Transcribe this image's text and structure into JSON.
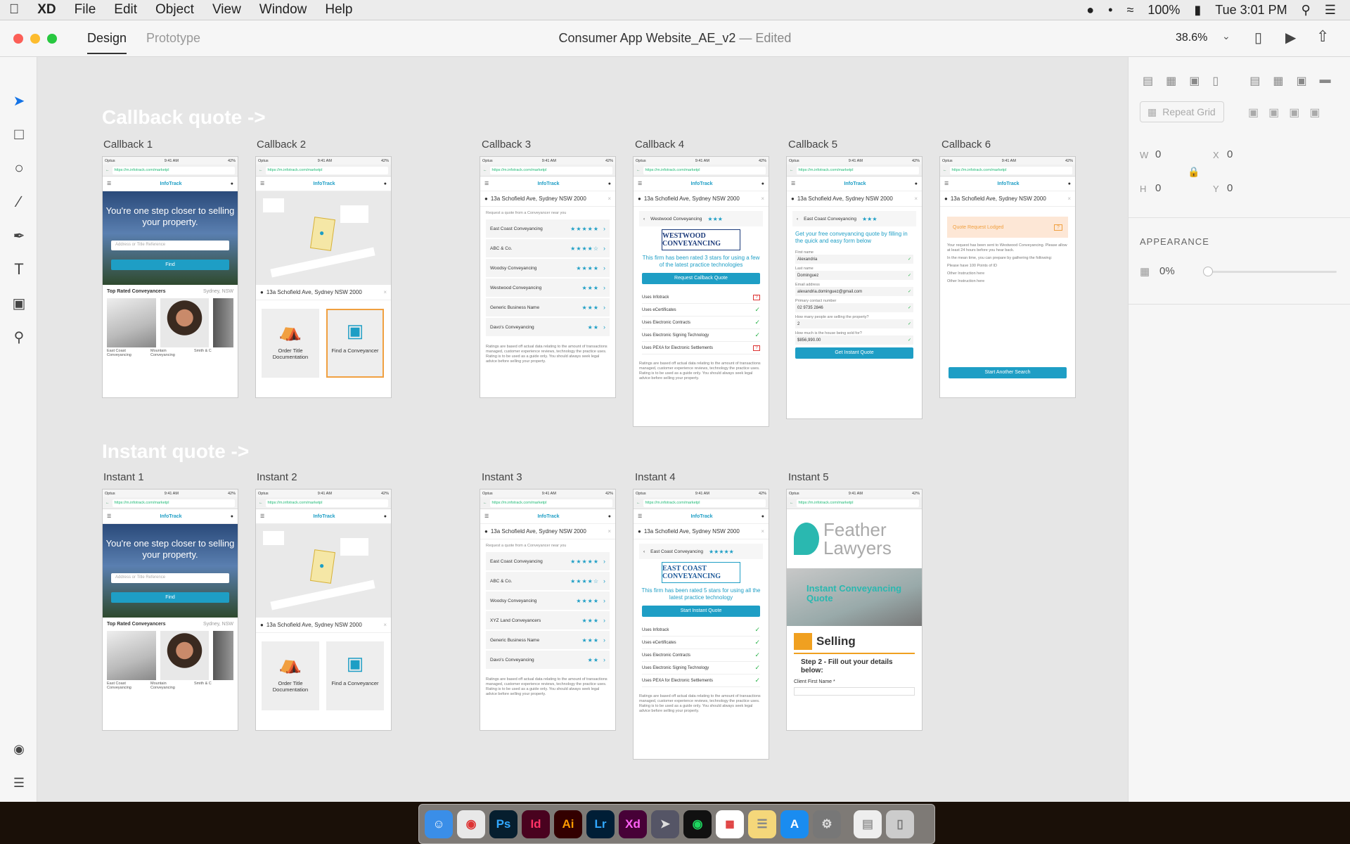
{
  "menubar": {
    "app": "XD",
    "menus": [
      "File",
      "Edit",
      "Object",
      "View",
      "Window",
      "Help"
    ],
    "battery": "100%",
    "clock": "Tue 3:01 PM"
  },
  "titlebar": {
    "tabs": [
      "Design",
      "Prototype"
    ],
    "document": "Consumer App Website_AE_v2",
    "dash": "—",
    "status": "Edited",
    "zoom": "38.6%"
  },
  "panel": {
    "repeat_grid": "Repeat Grid",
    "w_label": "W",
    "w_value": "0",
    "x_label": "X",
    "x_value": "0",
    "h_label": "H",
    "h_value": "0",
    "y_label": "Y",
    "y_value": "0",
    "appearance": "APPEARANCE",
    "opacity": "0%"
  },
  "sections": {
    "callback": "Callback quote ->",
    "instant": "Instant quote ->"
  },
  "labels": {
    "c1": "Callback 1",
    "c2": "Callback 2",
    "c3": "Callback 3",
    "c4": "Callback 4",
    "c5": "Callback 5",
    "c6": "Callback 6",
    "i1": "Instant 1",
    "i2": "Instant 2",
    "i3": "Instant 3",
    "i4": "Instant 4",
    "i5": "Instant 5"
  },
  "mock": {
    "carrier": "Optus",
    "time": "9:41 AM",
    "battery": "42%",
    "url": "https://m.infotrack.com/marketpl",
    "logo": "InfoTrack",
    "hero_text": "You're one step closer to selling your property.",
    "search_placeholder": "Address or Title Reference",
    "find": "Find",
    "top_rated": "Top Rated Conveyancers",
    "top_loc": "Sydney, NSW",
    "cap1": "East Coast Conveyancing",
    "cap2": "Mountain Conveyancing",
    "cap3": "Smith & C",
    "address": "13a Schofield Ave, Sydney NSW 2000",
    "tile_order": "Order Title Documentation",
    "tile_find": "Find a Conveyancer",
    "request_near": "Request a quote from a Conveyancer near you",
    "firms_a": [
      {
        "name": "East Coast Conveyancing",
        "stars": "★★★★★"
      },
      {
        "name": "ABC & Co.",
        "stars": "★★★★☆"
      },
      {
        "name": "Woodsy Conveyancing",
        "stars": "★★★★"
      },
      {
        "name": "Westwood Conveyancing",
        "stars": "★★★"
      },
      {
        "name": "Generic Business Name",
        "stars": "★★★"
      },
      {
        "name": "Davo's Conveyancing",
        "stars": "★★"
      }
    ],
    "firms_b": [
      {
        "name": "East Coast Conveyancing",
        "stars": "★★★★★"
      },
      {
        "name": "ABC & Co.",
        "stars": "★★★★☆"
      },
      {
        "name": "Woodsy Conveyancing",
        "stars": "★★★★"
      },
      {
        "name": "XYZ Land Conveyancers",
        "stars": "★★★"
      },
      {
        "name": "Generic Business Name",
        "stars": "★★★"
      },
      {
        "name": "Davo's Conveyancing",
        "stars": "★★"
      }
    ],
    "disclaimer": "Ratings are based off actual data relating to the amount of transactions managed, customer experience reviews, technology the practice uses. Rating is to be used as a guide only. You should always seek legal advice before selling your property.",
    "westwood": "Westwood Conveyancing",
    "westwood_logo": "WESTWOOD CONVEYANCING",
    "westwood_rated": "This firm has been rated 3 stars for using a few of the latest practice technologies",
    "request_callback": "Request Callback Quote",
    "eastcoast": "East Coast Conveyancing",
    "eastcoast_logo": "EAST COAST CONVEYANCING",
    "eastcoast_rated": "This firm has been rated 5 stars for using all the latest practice technology",
    "start_instant": "Start Instant Quote",
    "tech": [
      "Uses Infotrack",
      "Uses eCertificates",
      "Uses Electronic Contracts",
      "Uses Electronic Signing Technology",
      "Uses PEXA for Electronic Settlements"
    ],
    "form_title": "Get your free conveyancing quote by filling in the quick and easy form below",
    "fields": [
      {
        "label": "First name",
        "value": "Alexandria"
      },
      {
        "label": "Last name",
        "value": "Dominguez"
      },
      {
        "label": "Email address",
        "value": "alexandria.dominguez@gmail.com"
      },
      {
        "label": "Primary contact number",
        "value": "02 9735 2846"
      },
      {
        "label": "How many people are selling the property?",
        "value": "2"
      },
      {
        "label": "How much is the house being sold for?",
        "value": "$856,990.00"
      }
    ],
    "get_instant": "Get Instant Quote",
    "lodged": "Quote Request Lodged",
    "lodged_text": "Your request has been sent to Westwood Conveyancing. Please allow at least 24 hours before you hear back.",
    "meantime": "In the mean time, you can prepare by gathering the following:",
    "prep": [
      "Please have 100 Points of ID",
      "Other Instruction here",
      "Other Instruction here"
    ],
    "start_another": "Start Another Search",
    "feather1": "Feather",
    "feather2": "Lawyers",
    "instant_title": "Instant Conveyancing Quote",
    "selling": "Selling",
    "step2": "Step 2 - Fill out your details below:",
    "client_first": "Client First Name *"
  },
  "dock": [
    "Ps",
    "Id",
    "Ai",
    "Lr",
    "Xd"
  ],
  "colors": {
    "accent": "#1e9ec5",
    "xd": "#470137",
    "highlight": "#f0a040"
  }
}
